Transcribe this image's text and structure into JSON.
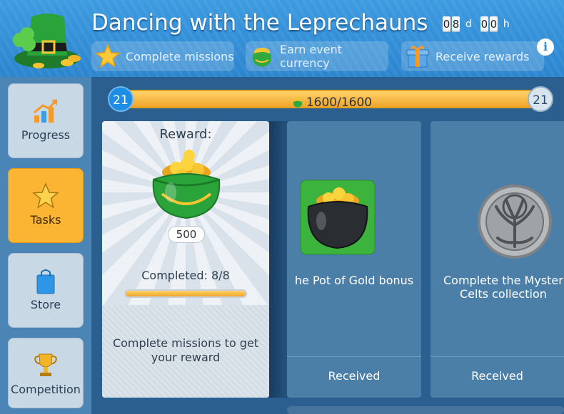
{
  "header": {
    "title": "Dancing with the Leprechauns",
    "timer": {
      "days_digits": [
        "0",
        "8"
      ],
      "days_unit": "d",
      "hours_digits": [
        "0",
        "0"
      ],
      "hours_unit": "h"
    },
    "steps": [
      {
        "label": "Complete missions",
        "icon": "star-icon"
      },
      {
        "label": "Earn event currency",
        "icon": "pot-of-gold-icon"
      },
      {
        "label": "Receive rewards",
        "icon": "gift-icon"
      }
    ],
    "info_label": "i"
  },
  "sidebar": {
    "items": [
      {
        "label": "Progress",
        "icon": "chart-arrow-icon",
        "active": false
      },
      {
        "label": "Tasks",
        "icon": "star-icon",
        "active": true
      },
      {
        "label": "Store",
        "icon": "shopping-bag-icon",
        "active": false
      },
      {
        "label": "Competition",
        "icon": "trophy-icon",
        "active": false
      }
    ]
  },
  "progress": {
    "level_left": "21",
    "level_right": "21",
    "value_text": "1600/1600",
    "fill_fraction": 1.0
  },
  "reward": {
    "label": "Reward:",
    "amount": "500",
    "completed_text": "Completed: 8/8",
    "completed_fraction": 1.0,
    "hint": "Complete missions to get your reward"
  },
  "tasks": [
    {
      "description": "he Pot of Gold bonus",
      "status": "Received",
      "icon": "black-pot-of-gold-icon"
    },
    {
      "description": "Complete the Myster\nCelts collection",
      "status": "Received",
      "icon": "celtic-tree-medallion-icon"
    }
  ],
  "colors": {
    "header_blue": "#2c85cf",
    "active_tab": "#fbb532",
    "progress_gold": "#f0a62a",
    "card_blue": "#4c7fa8"
  }
}
